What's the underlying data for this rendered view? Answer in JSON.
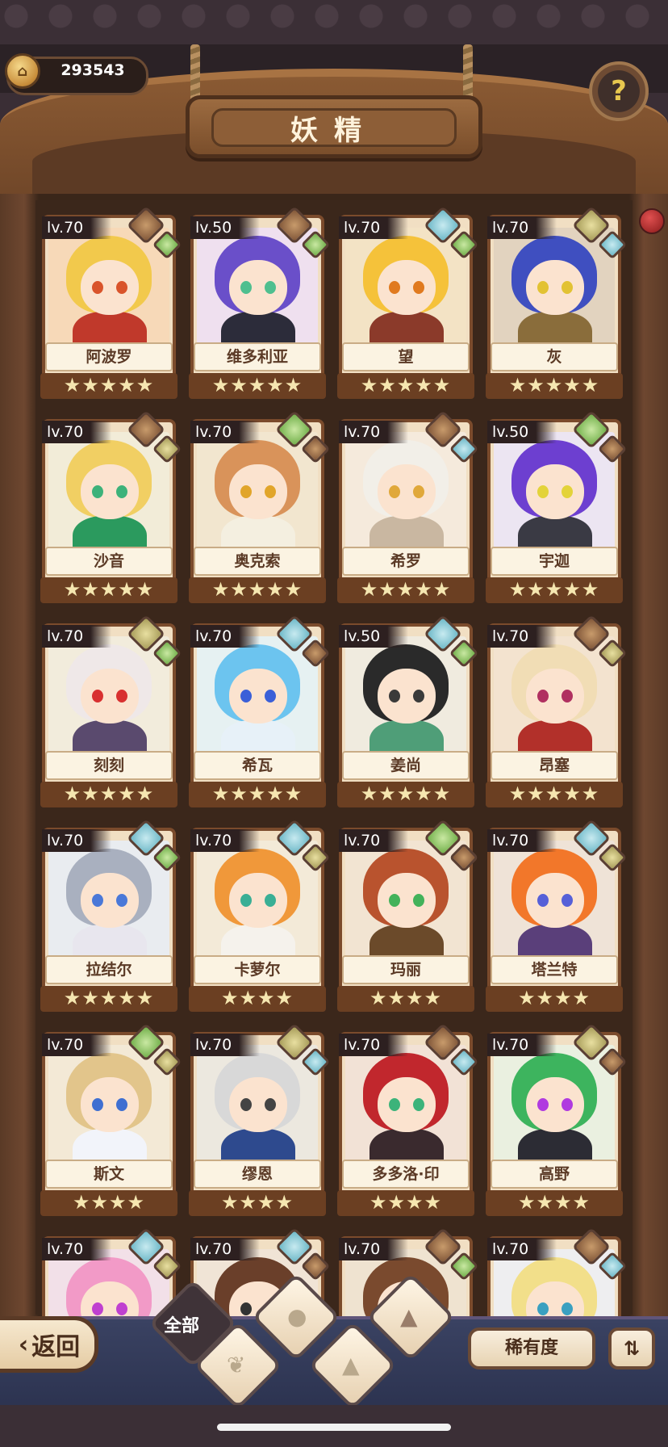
{
  "currency": {
    "value": "293543"
  },
  "header": {
    "title": "妖精"
  },
  "nav": {
    "back_label": "返回"
  },
  "filters": {
    "all_label": "全部",
    "sort_label": "稀有度"
  },
  "fairies": [
    {
      "level": "lv.70",
      "name": "阿波罗",
      "stars": "★★★★★",
      "hair": "#f2c94c",
      "eyes": "#d9542b",
      "outfit": "#c0392b",
      "gem1": "g-earth",
      "gem2": "g-plant",
      "bg": "#f7d9b8"
    },
    {
      "level": "lv.50",
      "name": "维多利亚",
      "stars": "★★★★★",
      "hair": "#6a4fc9",
      "eyes": "#4fbf8f",
      "outfit": "#2c2c3a",
      "gem1": "g-earth",
      "gem2": "g-plant",
      "bg": "#efe0ef"
    },
    {
      "level": "lv.70",
      "name": "望",
      "stars": "★★★★★",
      "hair": "#f5c23a",
      "eyes": "#e07a1f",
      "outfit": "#8b3a2a",
      "gem1": "g-water",
      "gem2": "g-plant",
      "bg": "#f3e3c5"
    },
    {
      "level": "lv.70",
      "name": "灰",
      "stars": "★★★★★",
      "hair": "#3f4fc0",
      "eyes": "#e2c233",
      "outfit": "#8a6d3b",
      "gem1": "g-sand",
      "gem2": "g-water",
      "bg": "#e2d3bf"
    },
    {
      "level": "lv.70",
      "name": "沙音",
      "stars": "★★★★★",
      "hair": "#f1cf63",
      "eyes": "#3db27a",
      "outfit": "#2b9a5e",
      "gem1": "g-earth",
      "gem2": "g-sand",
      "bg": "#f2ecd8"
    },
    {
      "level": "lv.70",
      "name": "奥克索",
      "stars": "★★★★★",
      "hair": "#d9935a",
      "eyes": "#e1a52a",
      "outfit": "#f4efe0",
      "gem1": "g-plant",
      "gem2": "g-earth",
      "bg": "#f2e6cf"
    },
    {
      "level": "lv.70",
      "name": "希罗",
      "stars": "★★★★★",
      "hair": "#f2efe8",
      "eyes": "#e0a83a",
      "outfit": "#c9b7a1",
      "gem1": "g-earth",
      "gem2": "g-water",
      "bg": "#f5eadc"
    },
    {
      "level": "lv.50",
      "name": "宇迦",
      "stars": "★★★★★",
      "hair": "#6d3fd0",
      "eyes": "#e3d33a",
      "outfit": "#3a3a44",
      "gem1": "g-plant",
      "gem2": "g-earth",
      "bg": "#ece5f2"
    },
    {
      "level": "lv.70",
      "name": "刻刻",
      "stars": "★★★★★",
      "hair": "#efe8e8",
      "eyes": "#d83030",
      "outfit": "#5a4a6e",
      "gem1": "g-sand",
      "gem2": "g-plant",
      "bg": "#f2ecdc"
    },
    {
      "level": "lv.70",
      "name": "希瓦",
      "stars": "★★★★★",
      "hair": "#6cc4ef",
      "eyes": "#3a5fd8",
      "outfit": "#e7f1f8",
      "gem1": "g-water",
      "gem2": "g-earth",
      "bg": "#e6f1f2"
    },
    {
      "level": "lv.50",
      "name": "姜尚",
      "stars": "★★★★★",
      "hair": "#2a2a2a",
      "eyes": "#3a3a3a",
      "outfit": "#4f9e78",
      "gem1": "g-water",
      "gem2": "g-plant",
      "bg": "#f0ebdf"
    },
    {
      "level": "lv.70",
      "name": "昂塞",
      "stars": "★★★★★",
      "hair": "#f1ddb5",
      "eyes": "#b03060",
      "outfit": "#b2302a",
      "gem1": "g-earth",
      "gem2": "g-sand",
      "bg": "#f3e3cf"
    },
    {
      "level": "lv.70",
      "name": "拉结尔",
      "stars": "★★★★★",
      "hair": "#a9b0bf",
      "eyes": "#4a78d8",
      "outfit": "#e8e6ee",
      "gem1": "g-water",
      "gem2": "g-plant",
      "bg": "#e9ecf0"
    },
    {
      "level": "lv.70",
      "name": "卡萝尔",
      "stars": "★★★★",
      "hair": "#f0983a",
      "eyes": "#3aaf95",
      "outfit": "#f5f2ec",
      "gem1": "g-water",
      "gem2": "g-sand",
      "bg": "#f3ead8"
    },
    {
      "level": "lv.70",
      "name": "玛丽",
      "stars": "★★★★",
      "hair": "#b9532e",
      "eyes": "#43b25a",
      "outfit": "#6b4a2a",
      "gem1": "g-plant",
      "gem2": "g-earth",
      "bg": "#f2e4d2"
    },
    {
      "level": "lv.70",
      "name": "塔兰特",
      "stars": "★★★★",
      "hair": "#f2772a",
      "eyes": "#5660d8",
      "outfit": "#5a3f7a",
      "gem1": "g-water",
      "gem2": "g-sand",
      "bg": "#efe3d7"
    },
    {
      "level": "lv.70",
      "name": "斯文",
      "stars": "★★★★",
      "hair": "#e2c58b",
      "eyes": "#3f6fd1",
      "outfit": "#f2f4fa",
      "gem1": "g-plant",
      "gem2": "g-sand",
      "bg": "#f3e9d6"
    },
    {
      "level": "lv.70",
      "name": "缪恩",
      "stars": "★★★★",
      "hair": "#d8d8d8",
      "eyes": "#444444",
      "outfit": "#2e4a8e",
      "gem1": "g-sand",
      "gem2": "g-water",
      "bg": "#ece8df"
    },
    {
      "level": "lv.70",
      "name": "多多洛·印",
      "stars": "★★★★",
      "hair": "#c1272d",
      "eyes": "#3cb37a",
      "outfit": "#3a2a2e",
      "gem1": "g-earth",
      "gem2": "g-water",
      "bg": "#f2e2d6"
    },
    {
      "level": "lv.70",
      "name": "高野",
      "stars": "★★★★",
      "hair": "#3db45e",
      "eyes": "#b03ae0",
      "outfit": "#2c2c34",
      "gem1": "g-sand",
      "gem2": "g-earth",
      "bg": "#eaf0e0"
    },
    {
      "level": "lv.70",
      "name": "",
      "stars": "",
      "hair": "#f29ac7",
      "eyes": "#c040d0",
      "outfit": "#555",
      "gem1": "g-water",
      "gem2": "g-sand",
      "bg": "#f2e0e8"
    },
    {
      "level": "lv.70",
      "name": "",
      "stars": "",
      "hair": "#6a3f2a",
      "eyes": "#333",
      "outfit": "#555",
      "gem1": "g-water",
      "gem2": "g-earth",
      "bg": "#f0e4d6"
    },
    {
      "level": "lv.70",
      "name": "",
      "stars": "",
      "hair": "#7a4a2e",
      "eyes": "#333",
      "outfit": "#555",
      "gem1": "g-earth",
      "gem2": "g-plant",
      "bg": "#efe3d0"
    },
    {
      "level": "lv.70",
      "name": "",
      "stars": "",
      "hair": "#f2df8a",
      "eyes": "#3aa0c0",
      "outfit": "#555",
      "gem1": "g-earth",
      "gem2": "g-water",
      "bg": "#eeeef0"
    }
  ]
}
